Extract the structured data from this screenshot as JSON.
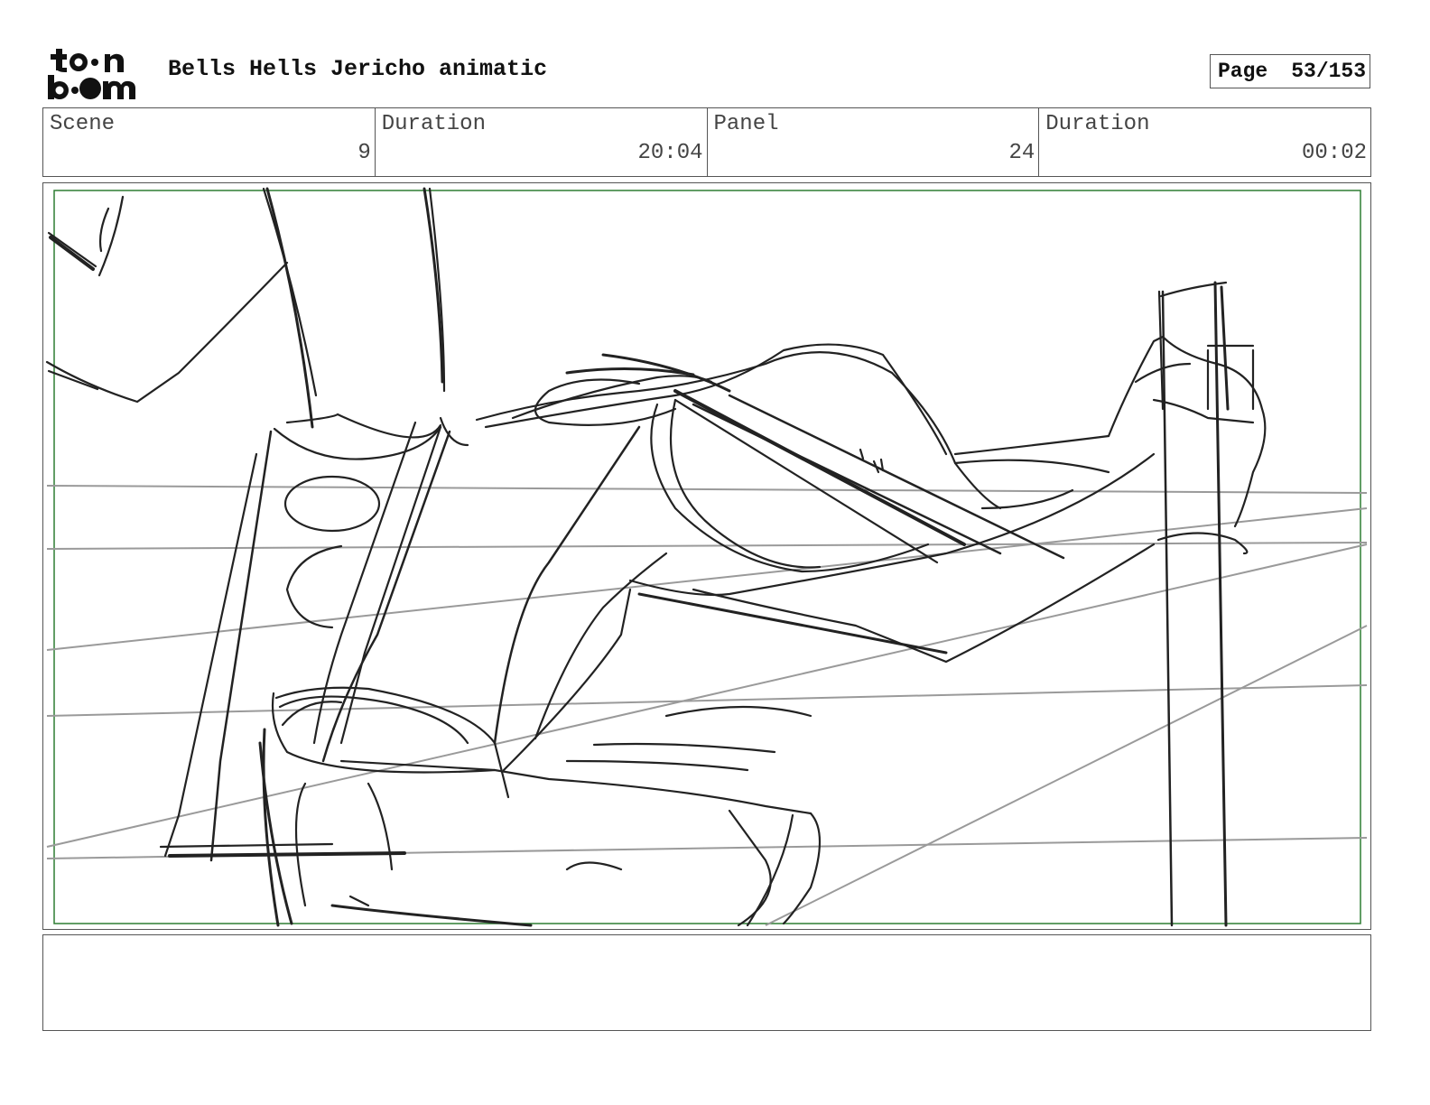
{
  "header": {
    "logo_alt": "toon boom",
    "title": "Bells Hells Jericho animatic",
    "page_label": "Page",
    "page_number": "53/153"
  },
  "info": {
    "scene_label": "Scene",
    "scene_value": "9",
    "scene_duration_label": "Duration",
    "scene_duration_value": "20:04",
    "panel_label": "Panel",
    "panel_value": "24",
    "panel_duration_label": "Duration",
    "panel_duration_value": "00:02"
  },
  "notes": {
    "text": ""
  },
  "colors": {
    "frame_border": "#555555",
    "safe_area": "#2e7d32",
    "sketch": "#222222",
    "guide": "#9a9a9a"
  }
}
